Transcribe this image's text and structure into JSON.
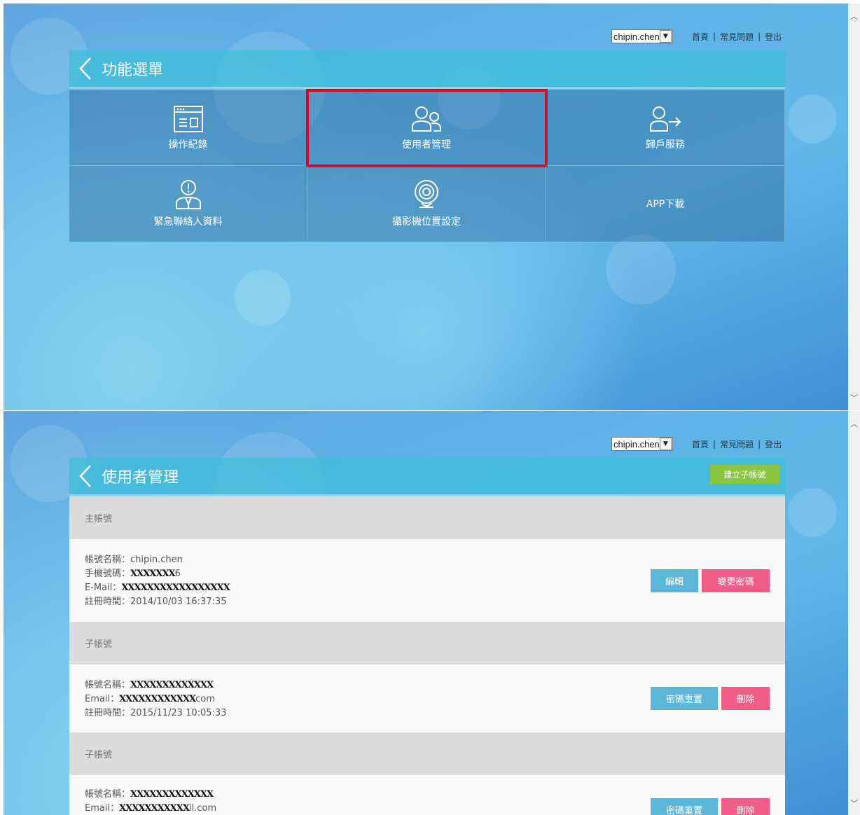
{
  "screen1": {
    "account_select": "chipin.chen",
    "top_links": [
      "首頁",
      "常見問題",
      "登出"
    ],
    "title": "功能選單",
    "tiles": [
      {
        "label": "操作紀錄",
        "icon": "log-window-icon"
      },
      {
        "label": "使用者管理",
        "icon": "users-icon",
        "highlighted": true
      },
      {
        "label": "歸戶服務",
        "icon": "user-transfer-icon"
      },
      {
        "label": "緊急聯絡人資料",
        "icon": "emergency-contact-icon"
      },
      {
        "label": "攝影機位置設定",
        "icon": "camera-icon"
      },
      {
        "label": "APP下載",
        "icon": ""
      }
    ]
  },
  "screen2": {
    "account_select": "chipin.chen",
    "top_links": [
      "首頁",
      "常見問題",
      "登出"
    ],
    "title": "使用者管理",
    "create_button": "建立子帳號",
    "main_header": "主帳號",
    "main_account": {
      "name_label": "帳號名稱：",
      "name_value": "chipin.chen",
      "phone_label": "手機號碼：",
      "phone_value": "XXXXXXX",
      "phone_suffix": "6",
      "email_label": "E-Mail：",
      "email_value": "XXXXXXXXXXXXXXXXX",
      "reg_label": "註冊時間：",
      "reg_value": "2014/10/03 16:37:35",
      "edit_button": "編輯",
      "change_pw_button": "變更密碼"
    },
    "sub_header": "子帳號",
    "sub_accounts": [
      {
        "name_label": "帳號名稱：",
        "name_value": "XXXXXXXXXXXXX",
        "email_label": "Email：",
        "email_value": "XXXXXXXXXXXX",
        "email_suffix": "com",
        "reg_label": "註冊時間：",
        "reg_value": "2015/11/23 10:05:33",
        "reset_button": "密碼重置",
        "delete_button": "刪除"
      },
      {
        "name_label": "帳號名稱：",
        "name_value": "XXXXXXXXXXXXX",
        "email_label": "Email：",
        "email_value": "XXXXXXXXXXX",
        "email_suffix": "il.com",
        "reset_button": "密碼重置",
        "delete_button": "刪除"
      }
    ]
  },
  "colors": {
    "highlight": "#e8001c",
    "create": "#8cc63f",
    "blue_btn": "#5bb6d7",
    "pink_btn": "#f05d87"
  }
}
